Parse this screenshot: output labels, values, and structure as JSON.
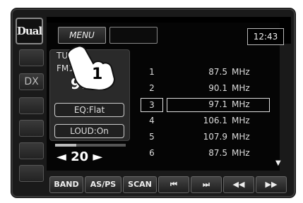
{
  "logo": "Dual",
  "header": {
    "menu_label": "MENU",
    "clock": "12:43"
  },
  "side": {
    "dx_label": "DX"
  },
  "tuner": {
    "label": "TUNER",
    "band": "FM1",
    "current_freq": "97.1",
    "eq_label": "EQ:Flat",
    "loud_label": "LOUD:On",
    "volume_level": 0.3,
    "volume_display": "◄ 20 ►"
  },
  "presets": [
    {
      "num": "1",
      "freq": "87.5",
      "unit": "MHz"
    },
    {
      "num": "2",
      "freq": "90.1",
      "unit": "MHz"
    },
    {
      "num": "3",
      "freq": "97.1",
      "unit": "MHz"
    },
    {
      "num": "4",
      "freq": "106.1",
      "unit": "MHz"
    },
    {
      "num": "5",
      "freq": "107.9",
      "unit": "MHz"
    },
    {
      "num": "6",
      "freq": "87.5",
      "unit": "MHz"
    }
  ],
  "selected_preset": "3",
  "callout_number": "1",
  "bottom": {
    "band": "BAND",
    "asps": "AS/PS",
    "scan": "SCAN",
    "prev_track": "⏮",
    "next_track": "⏭",
    "rewind": "◀◀",
    "forward": "▶▶"
  },
  "icons": {
    "scroll": "down-arrow-icon",
    "volume": "speaker-icon"
  }
}
